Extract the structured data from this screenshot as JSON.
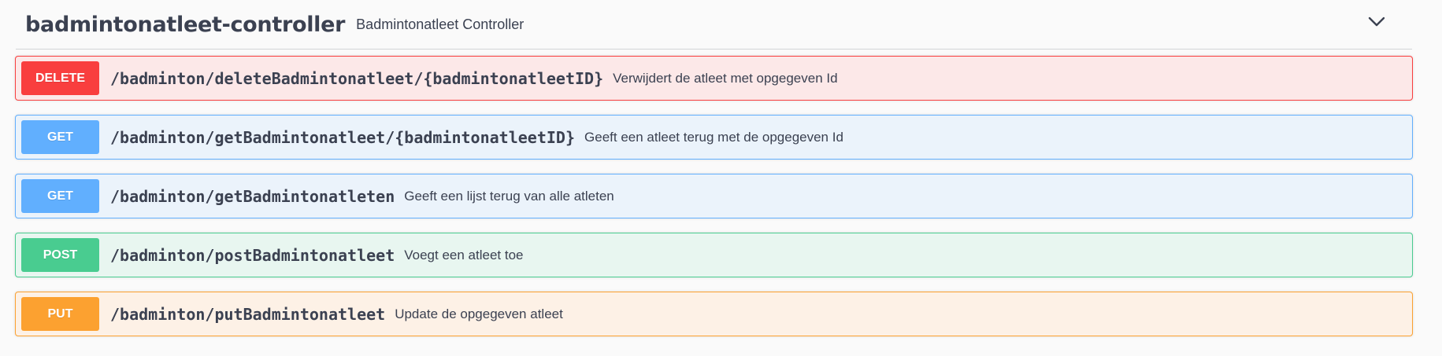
{
  "controller": {
    "name": "badmintonatleet-controller",
    "description": "Badmintonatleet Controller",
    "expanded_icon": "chevron-down-icon"
  },
  "operations": [
    {
      "method": "DELETE",
      "path": "/badminton/deleteBadmintonatleet/{badmintonatleetID}",
      "summary": "Verwijdert de atleet met opgegeven Id"
    },
    {
      "method": "GET",
      "path": "/badminton/getBadmintonatleet/{badmintonatleetID}",
      "summary": "Geeft een atleet terug met de opgegeven Id"
    },
    {
      "method": "GET",
      "path": "/badminton/getBadmintonatleten",
      "summary": "Geeft een lijst terug van alle atleten"
    },
    {
      "method": "POST",
      "path": "/badminton/postBadmintonatleet",
      "summary": "Voegt een atleet toe"
    },
    {
      "method": "PUT",
      "path": "/badminton/putBadmintonatleet",
      "summary": "Update de opgegeven atleet"
    }
  ],
  "colors": {
    "delete": "#f93e3e",
    "get": "#61affe",
    "post": "#49cc90",
    "put": "#fca130",
    "text": "#3b4151"
  }
}
